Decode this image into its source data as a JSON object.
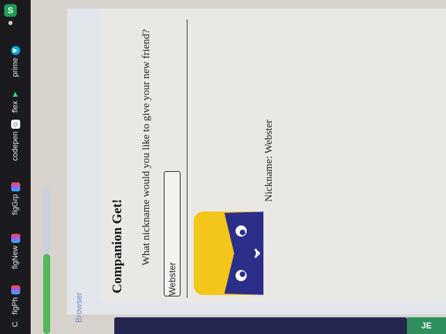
{
  "bookmarks": [
    {
      "label": "figPh",
      "icon": "figma-icon",
      "color": "#f24e1e"
    },
    {
      "label": "figNew",
      "icon": "figma-icon",
      "color": "#a259ff"
    },
    {
      "label": "figGrp",
      "icon": "figma-icon",
      "color": "#1abcfe"
    },
    {
      "label": "codepen",
      "icon": "codepen-icon",
      "color": "#ffffff"
    },
    {
      "label": "flex",
      "icon": "android-icon",
      "color": "#3ddc84"
    },
    {
      "label": "prime",
      "icon": "prime-play-icon",
      "color": "#00a8e1"
    }
  ],
  "bookmarks_cut_label": "C",
  "extension": {
    "letter": "S",
    "color": "#1f9d55"
  },
  "browser": {
    "label": "Browser"
  },
  "page": {
    "title": "Companion Get!",
    "prompt": "What nickname would you like to give your new friend?",
    "input_value": "Webster",
    "nickname_line": "Nickname: Webster"
  },
  "corner_text": "JE",
  "colors": {
    "pet_body": "#2b2f8a",
    "pet_background": "#f4c51a",
    "progress": "#53b85a",
    "footer": "#23264e"
  },
  "progress_fraction": 0.55
}
